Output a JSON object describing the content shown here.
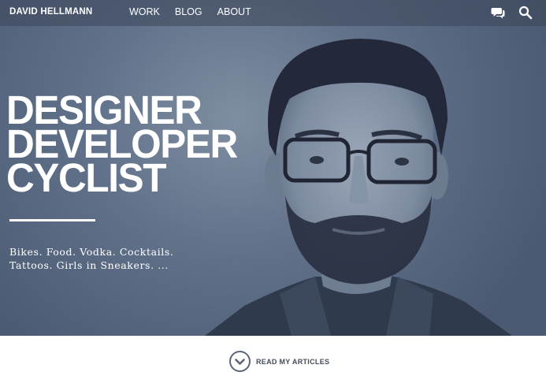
{
  "header": {
    "brand": "DAVID HELLMANN",
    "nav": [
      {
        "label": "WORK"
      },
      {
        "label": "BLOG"
      },
      {
        "label": "ABOUT"
      }
    ],
    "icons": {
      "chat": "chat-bubbles-icon",
      "search": "search-icon"
    }
  },
  "hero": {
    "headline": [
      "DESIGNER",
      "DEVELOPER",
      "CYCLIST"
    ],
    "tagline": [
      "Bikes. Food. Vodka. Cocktails.",
      "Tattoos. Girls in Sneakers. ..."
    ],
    "image": "portrait-photo"
  },
  "footer": {
    "cta_label": "READ MY ARTICLES",
    "cta_icon": "chevron-down-icon"
  },
  "colors": {
    "hero_tint": "#61718a",
    "topbar": "#3a465a",
    "text_light": "#ffffff",
    "footer_text": "#454d5a"
  }
}
